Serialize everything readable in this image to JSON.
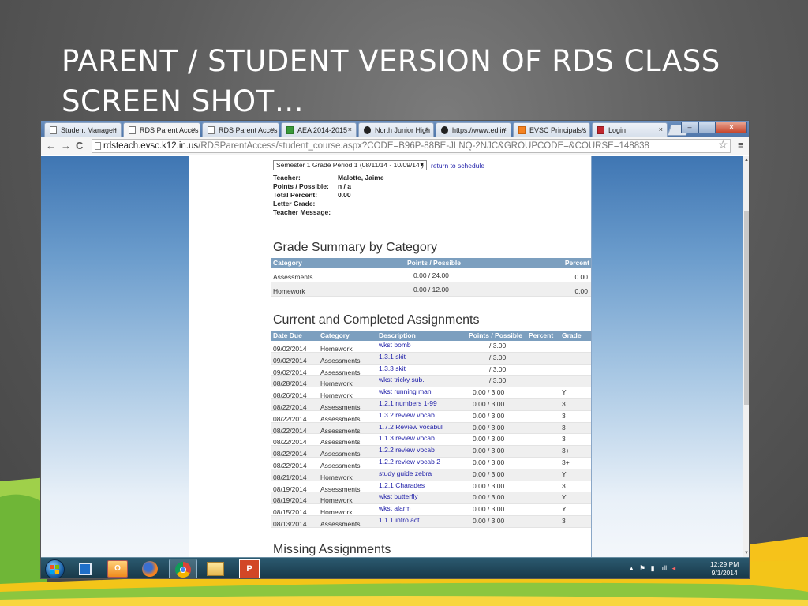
{
  "slide": {
    "title": "PARENT / STUDENT VERSION OF RDS CLASS\nSCREEN SHOT…"
  },
  "browser": {
    "tabs": [
      {
        "label": "Student Managem",
        "icon": "page-icon",
        "color": "plain"
      },
      {
        "label": "RDS Parent Acces",
        "icon": "page-icon",
        "color": "plain",
        "active": true
      },
      {
        "label": "RDS Parent Acces",
        "icon": "page-icon",
        "color": "plain"
      },
      {
        "label": "AEA 2014-2015",
        "icon": "sheet-icon",
        "color": "green"
      },
      {
        "label": "North Junior High",
        "icon": "swirl-icon",
        "color": "swirl"
      },
      {
        "label": "https://www.edlin",
        "icon": "swirl-icon",
        "color": "swirl"
      },
      {
        "label": "EVSC Principals's I",
        "icon": "blogger-icon",
        "color": "orange"
      },
      {
        "label": "Login",
        "icon": "login-icon",
        "color": "red"
      }
    ],
    "url_host": "rdsteach.evsc.k12.in.us",
    "url_path": "/RDSParentAccess/student_course.aspx?CODE=B96P-88BE-JLNQ-2NJC&GROUPCODE=&COURSE=148838"
  },
  "course": {
    "period_selected": "Semester 1 Grade Period 1 (08/11/14 - 10/09/14 )",
    "return_link": "return to schedule",
    "info": [
      {
        "label": "Teacher:",
        "value": "Malotte, Jaime"
      },
      {
        "label": "Points / Possible:",
        "value": "n / a"
      },
      {
        "label": "Total Percent:",
        "value": "0.00"
      },
      {
        "label": "Letter Grade:",
        "value": ""
      },
      {
        "label": "Teacher Message:",
        "value": ""
      }
    ]
  },
  "summary": {
    "heading": "Grade Summary by Category",
    "headers": {
      "category": "Category",
      "points": "Points / Possible",
      "percent": "Percent"
    },
    "rows": [
      {
        "category": "Assessments",
        "points": "0.00 / 24.00",
        "percent": "0.00"
      },
      {
        "category": "Homework",
        "points": "0.00 / 12.00",
        "percent": "0.00"
      }
    ]
  },
  "assignments": {
    "heading": "Current and Completed Assignments",
    "headers": {
      "date": "Date Due",
      "category": "Category",
      "description": "Description",
      "points": "Points / Possible",
      "percent": "Percent",
      "grade": "Grade"
    },
    "rows": [
      {
        "date": "09/02/2014",
        "category": "Homework",
        "description": "wkst bomb",
        "points": "/ 3.00",
        "percent": "",
        "grade": ""
      },
      {
        "date": "09/02/2014",
        "category": "Assessments",
        "description": "1.3.1 skit",
        "points": "/ 3.00",
        "percent": "",
        "grade": ""
      },
      {
        "date": "09/02/2014",
        "category": "Assessments",
        "description": "1.3.3 skit",
        "points": "/ 3.00",
        "percent": "",
        "grade": ""
      },
      {
        "date": "08/28/2014",
        "category": "Homework",
        "description": "wkst tricky sub.",
        "points": "/ 3.00",
        "percent": "",
        "grade": ""
      },
      {
        "date": "08/26/2014",
        "category": "Homework",
        "description": "wkst running man",
        "points": "0.00 / 3.00",
        "percent": "",
        "grade": "Y"
      },
      {
        "date": "08/22/2014",
        "category": "Assessments",
        "description": "1.2.1 numbers 1-99",
        "points": "0.00 / 3.00",
        "percent": "",
        "grade": "3"
      },
      {
        "date": "08/22/2014",
        "category": "Assessments",
        "description": "1.3.2 review vocab",
        "points": "0.00 / 3.00",
        "percent": "",
        "grade": "3"
      },
      {
        "date": "08/22/2014",
        "category": "Assessments",
        "description": "1.7.2 Review vocabul",
        "points": "0.00 / 3.00",
        "percent": "",
        "grade": "3"
      },
      {
        "date": "08/22/2014",
        "category": "Assessments",
        "description": "1.1.3 review vocab",
        "points": "0.00 / 3.00",
        "percent": "",
        "grade": "3"
      },
      {
        "date": "08/22/2014",
        "category": "Assessments",
        "description": "1.2.2 review vocab",
        "points": "0.00 / 3.00",
        "percent": "",
        "grade": "3+"
      },
      {
        "date": "08/22/2014",
        "category": "Assessments",
        "description": "1.2.2 review vocab 2",
        "points": "0.00 / 3.00",
        "percent": "",
        "grade": "3+"
      },
      {
        "date": "08/21/2014",
        "category": "Homework",
        "description": "study guide zebra",
        "points": "0.00 / 3.00",
        "percent": "",
        "grade": "Y"
      },
      {
        "date": "08/19/2014",
        "category": "Assessments",
        "description": "1.2.1 Charades",
        "points": "0.00 / 3.00",
        "percent": "",
        "grade": "3"
      },
      {
        "date": "08/19/2014",
        "category": "Homework",
        "description": "wkst butterfly",
        "points": "0.00 / 3.00",
        "percent": "",
        "grade": "Y"
      },
      {
        "date": "08/15/2014",
        "category": "Homework",
        "description": "wkst alarm",
        "points": "0.00 / 3.00",
        "percent": "",
        "grade": "Y"
      },
      {
        "date": "08/13/2014",
        "category": "Assessments",
        "description": "1.1.1 intro act",
        "points": "0.00 / 3.00",
        "percent": "",
        "grade": "3"
      }
    ]
  },
  "missing": {
    "heading": "Missing Assignments"
  },
  "taskbar": {
    "time": "12:29 PM",
    "date": "9/1/2014",
    "apps": [
      "outlook-icon",
      "powerpoint-icon",
      "firefox-icon",
      "chrome-icon",
      "file-explorer-icon",
      "powerpoint-icon"
    ]
  },
  "colors": {
    "table_header": "#7c9fbf",
    "link": "#2222aa",
    "taskbar": "#1f3f52"
  }
}
